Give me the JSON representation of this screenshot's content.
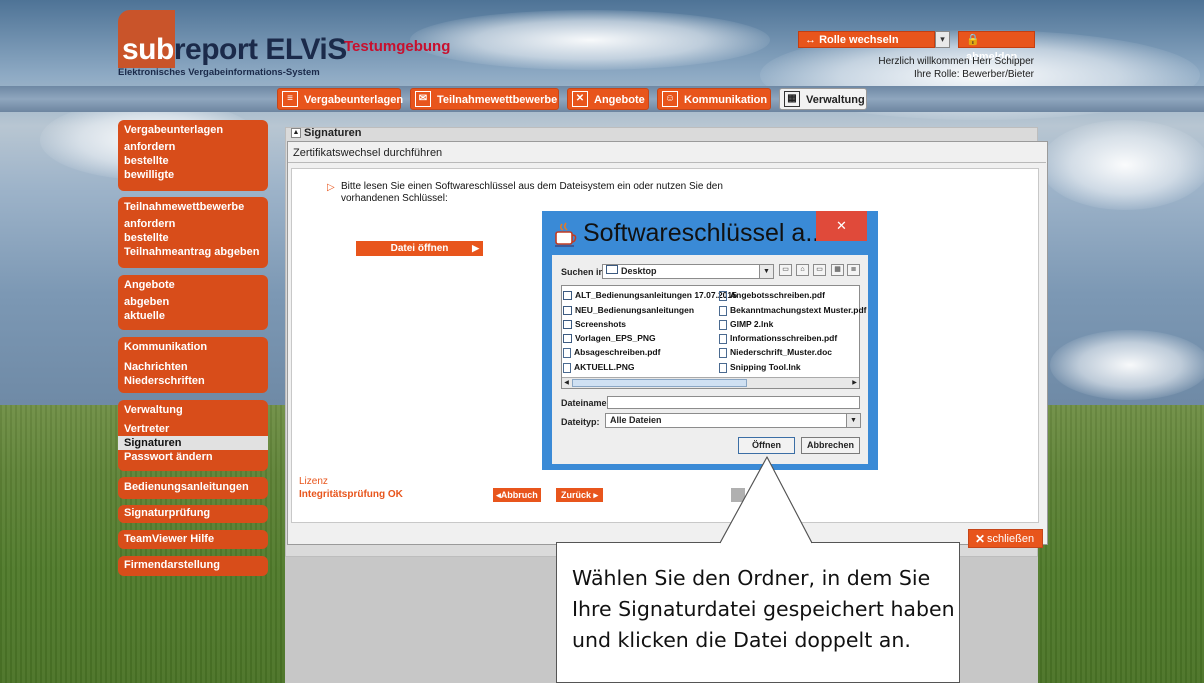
{
  "brand": {
    "logo_sub": "sub",
    "logo_main": "report ELViS",
    "tagline": "Elektronisches Vergabeinformations-System",
    "environment": "Testumgebung",
    "accent_color": "#e8551c"
  },
  "header": {
    "role_switch_label": "Rolle wechseln",
    "logout_label": "abmelden",
    "welcome": "Herzlich willkommen Herr Schipper",
    "role_info": "Ihre Rolle: Bewerber/Bieter"
  },
  "nav": {
    "tabs": [
      {
        "label": "Vergabeunterlagen",
        "icon": "document-icon"
      },
      {
        "label": "Teilnahmewettbewerbe",
        "icon": "certificate-icon"
      },
      {
        "label": "Angebote",
        "icon": "envelope-icon"
      },
      {
        "label": "Kommunikation",
        "icon": "people-icon"
      },
      {
        "label": "Verwaltung",
        "icon": "grid-icon",
        "active": true
      }
    ]
  },
  "sidebar": {
    "groups": [
      {
        "title": "Vergabeunterlagen",
        "items": [
          "anfordern",
          "bestellte",
          "bewilligte"
        ]
      },
      {
        "title": "Teilnahmewettbewerbe",
        "items": [
          "anfordern",
          "bestellte",
          "Teilnahmeantrag abgeben"
        ]
      },
      {
        "title": "Angebote",
        "items": [
          "abgeben",
          "aktuelle"
        ]
      },
      {
        "title": "Kommunikation",
        "items": [
          "Nachrichten",
          "Niederschriften"
        ]
      },
      {
        "title": "Verwaltung",
        "items": [
          "Vertreter",
          "Signaturen",
          "Passwort ändern"
        ],
        "selected": "Signaturen"
      },
      {
        "title": "Bedienungsanleitungen",
        "items": []
      },
      {
        "title": "Signaturprüfung",
        "items": []
      },
      {
        "title": "TeamViewer Hilfe",
        "items": []
      },
      {
        "title": "Firmendarstellung",
        "items": []
      }
    ]
  },
  "panel": {
    "title": "Signaturen",
    "dialog_title": "Zertifikatswechsel durchführen",
    "instruction": "Bitte lesen Sie einen Softwareschlüssel aus dem Dateisystem ein oder nutzen Sie den vorhandenen Schlüssel:",
    "open_file_button": "Datei öffnen",
    "lizenz_label": "Lizenz",
    "integrity_label": "Integritätsprüfung OK",
    "abort_button": "Abbruch",
    "back_button": "Zurück",
    "close_button": "schließen"
  },
  "file_dialog": {
    "title": "Softwareschlüssel a...",
    "look_in_label": "Suchen in:",
    "look_in_value": "Desktop",
    "files_left": [
      {
        "name": "ALT_Bedienungsanleitungen 17.07.2015",
        "type": "folder"
      },
      {
        "name": "NEU_Bedienungsanleitungen",
        "type": "folder"
      },
      {
        "name": "Screenshots",
        "type": "folder"
      },
      {
        "name": "Vorlagen_EPS_PNG",
        "type": "folder"
      },
      {
        "name": "Absageschreiben.pdf",
        "type": "file"
      },
      {
        "name": "AKTUELL.PNG",
        "type": "file"
      }
    ],
    "files_right": [
      {
        "name": "Angebotsschreiben.pdf",
        "type": "file"
      },
      {
        "name": "Bekanntmachungstext Muster.pdf",
        "type": "file"
      },
      {
        "name": "GIMP 2.lnk",
        "type": "file"
      },
      {
        "name": "Informationsschreiben.pdf",
        "type": "file"
      },
      {
        "name": "Niederschrift_Muster.doc",
        "type": "file"
      },
      {
        "name": "Snipping Tool.lnk",
        "type": "file"
      }
    ],
    "filename_label": "Dateiname:",
    "filename_value": "",
    "filetype_label": "Dateityp:",
    "filetype_value": "Alle Dateien",
    "open_button": "Öffnen",
    "cancel_button": "Abbrechen"
  },
  "callout": {
    "text": "Wählen Sie den Ordner, in dem Sie Ihre Signaturdatei gespeichert haben und klicken die Datei doppelt an."
  }
}
